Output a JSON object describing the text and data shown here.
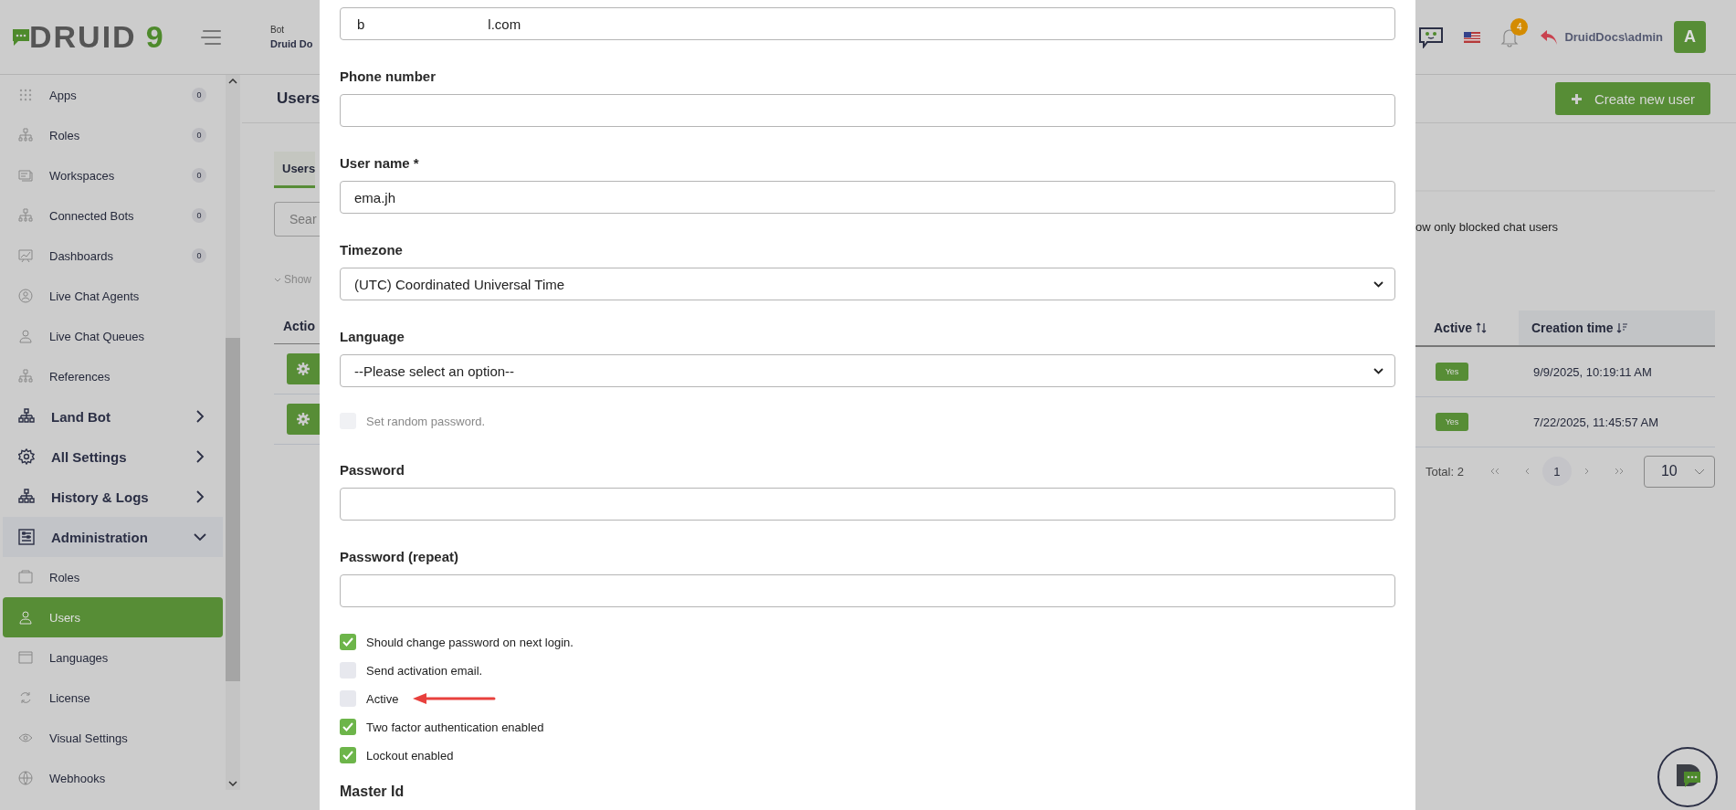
{
  "logo": {
    "text": "DRUID",
    "mark": "9"
  },
  "header": {
    "bot_label": "Bot",
    "bot_name": "Druid Do",
    "notifications": "4",
    "user": "DruidDocs\\admin",
    "avatar": "A"
  },
  "sidebar": {
    "items": [
      {
        "kind": "link",
        "label": "Apps",
        "badge": "0",
        "selected": false
      },
      {
        "kind": "link",
        "label": "Roles",
        "badge": "0",
        "selected": false
      },
      {
        "kind": "link",
        "label": "Workspaces",
        "badge": "0",
        "selected": false
      },
      {
        "kind": "link",
        "label": "Connected Bots",
        "badge": "0",
        "selected": false
      },
      {
        "kind": "link",
        "label": "Dashboards",
        "badge": "0",
        "selected": false
      },
      {
        "kind": "link",
        "label": "Live Chat Agents",
        "selected": false
      },
      {
        "kind": "link",
        "label": "Live Chat Queues",
        "selected": false
      },
      {
        "kind": "link",
        "label": "References",
        "selected": false
      },
      {
        "kind": "section",
        "label": "Land Bot",
        "expanded": false
      },
      {
        "kind": "section",
        "label": "All Settings",
        "expanded": false
      },
      {
        "kind": "section",
        "label": "History & Logs",
        "expanded": false
      },
      {
        "kind": "section",
        "label": "Administration",
        "expanded": true,
        "children": [
          {
            "label": "Roles",
            "selected": false
          },
          {
            "label": "Users",
            "selected": true
          },
          {
            "label": "Languages",
            "selected": false
          },
          {
            "label": "License",
            "selected": false
          },
          {
            "label": "Visual Settings",
            "selected": false
          },
          {
            "label": "Webhooks",
            "selected": false
          }
        ]
      }
    ]
  },
  "page": {
    "title": "Users",
    "tab": "Users",
    "search_placeholder": "Sear",
    "show_toggle": "Show",
    "filter_label": "ow only blocked chat users",
    "create_button": "Create new user",
    "table": {
      "columns": [
        "Actio",
        "Active",
        "Creation time"
      ],
      "rows": [
        {
          "active": "Yes",
          "created": "9/9/2025, 10:19:11 AM"
        },
        {
          "active": "Yes",
          "created": "7/22/2025, 11:45:57 AM"
        }
      ]
    },
    "pagination": {
      "total": "Total: 2",
      "current": "1",
      "page_size": "10"
    }
  },
  "modal": {
    "email": {
      "value_parts": [
        "b",
        "l.com"
      ]
    },
    "fields": [
      {
        "kind": "input",
        "label": "Phone number"
      },
      {
        "kind": "input",
        "label": "User name *",
        "value": "ema.jh"
      },
      {
        "kind": "select",
        "label": "Timezone",
        "value": "(UTC) Coordinated Universal Time"
      },
      {
        "kind": "select",
        "label": "Language",
        "value": "--Please select an option--"
      },
      {
        "kind": "checkbox",
        "label": "Set random password.",
        "checked": false,
        "disabled": true
      },
      {
        "kind": "input",
        "label": "Password"
      },
      {
        "kind": "input",
        "label": "Password (repeat)"
      }
    ],
    "options": [
      {
        "label": "Should change password on next login.",
        "checked": true,
        "pointed": false
      },
      {
        "label": "Send activation email.",
        "checked": false,
        "pointed": false
      },
      {
        "label": "Active",
        "checked": false,
        "pointed": true
      },
      {
        "label": "Two factor authentication enabled",
        "checked": true,
        "pointed": false
      },
      {
        "label": "Lockout enabled",
        "checked": true,
        "pointed": false
      }
    ],
    "next_label": "Master Id"
  }
}
